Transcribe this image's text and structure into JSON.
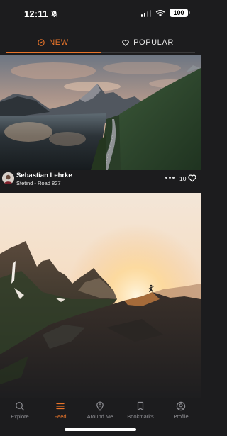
{
  "status_bar": {
    "time": "12:11",
    "battery": "100"
  },
  "tabs": [
    {
      "label": "NEW",
      "active": true,
      "icon": "compass-icon"
    },
    {
      "label": "POPULAR",
      "active": false,
      "icon": "heart-icon"
    }
  ],
  "feed": [
    {
      "author": "Sebastian Lehrke",
      "location": "Stetind - Road 827",
      "likes": "10"
    }
  ],
  "bottom_nav": [
    {
      "label": "Explore",
      "icon": "search-icon",
      "active": false
    },
    {
      "label": "Feed",
      "icon": "feed-list-icon",
      "active": true
    },
    {
      "label": "Around Me",
      "icon": "location-pin-icon",
      "active": false
    },
    {
      "label": "Bookmarks",
      "icon": "bookmark-icon",
      "active": false
    },
    {
      "label": "Profile",
      "icon": "profile-icon",
      "active": false
    }
  ],
  "colors": {
    "accent": "#e8742a",
    "background": "#1c1c1e",
    "inactive": "#8e8e93"
  }
}
